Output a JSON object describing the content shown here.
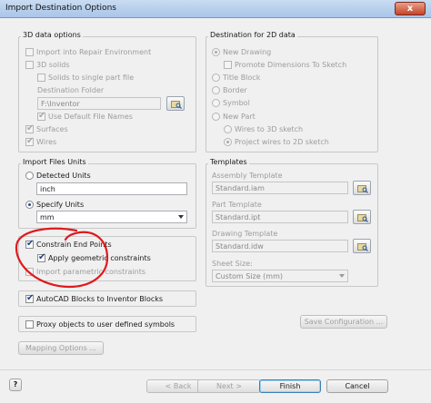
{
  "window": {
    "title": "Import Destination Options",
    "close_label": "x"
  },
  "data3d": {
    "group_label": "3D data options",
    "import_repair": "Import into Repair Environment",
    "solids_3d": "3D solids",
    "solids_single": "Solids to single part file",
    "dest_folder_label": "Destination Folder",
    "dest_folder_value": "F:\\Inventor",
    "use_default_names": "Use Default File Names",
    "surfaces": "Surfaces",
    "wires": "Wires"
  },
  "dest2d": {
    "group_label": "Destination for 2D data",
    "new_drawing": "New Drawing",
    "promote_dims": "Promote Dimensions To Sketch",
    "title_block": "Title Block",
    "border": "Border",
    "symbol": "Symbol",
    "new_part": "New Part",
    "wires_3d": "Wires to 3D sketch",
    "project_wires": "Project wires to 2D sketch"
  },
  "units": {
    "group_label": "Import Files Units",
    "detected": "Detected Units",
    "detected_value": "inch",
    "specify": "Specify Units",
    "specify_value": "mm"
  },
  "templates": {
    "group_label": "Templates",
    "assembly_label": "Assembly Template",
    "assembly_value": "Standard.iam",
    "part_label": "Part Template",
    "part_value": "Standard.ipt",
    "drawing_label": "Drawing Template",
    "drawing_value": "Standard.idw",
    "sheet_label": "Sheet Size:",
    "sheet_value": "Custom Size (mm)"
  },
  "constraints": {
    "end_points": "Constrain End Points",
    "geometric": "Apply geometric constraints",
    "parametric": "Import parametric constraints"
  },
  "options": {
    "autocad_blocks": "AutoCAD Blocks to Inventor Blocks",
    "proxy_objects": "Proxy objects to user defined symbols",
    "save_config": "Save Configuration ...",
    "mapping": "Mapping Options ..."
  },
  "footer": {
    "help": "?",
    "back": "< Back",
    "next": "Next >",
    "finish": "Finish",
    "cancel": "Cancel"
  },
  "annotation_color": "#e0191d"
}
